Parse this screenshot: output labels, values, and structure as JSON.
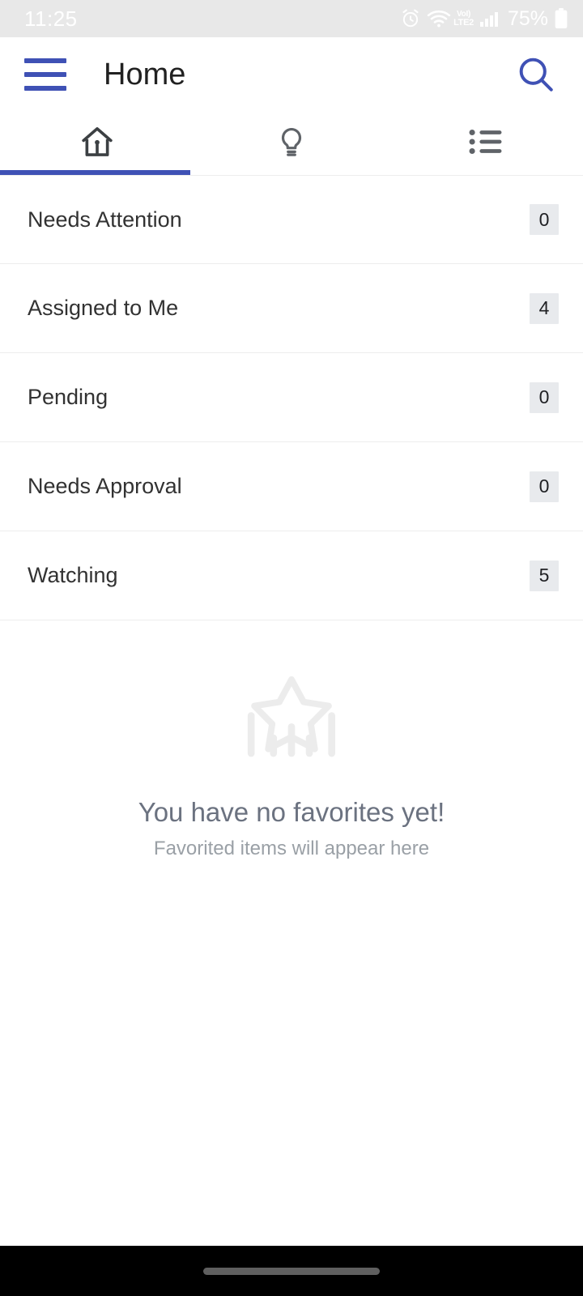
{
  "status_bar": {
    "time": "11:25",
    "battery_percent": "75%",
    "network_label_top": "VoI)",
    "network_label_bottom": "LTE2",
    "icons": [
      "alarm-icon",
      "wifi-icon",
      "volte-icon",
      "signal-icon",
      "battery-icon"
    ]
  },
  "app_bar": {
    "title": "Home",
    "menu_icon": "hamburger-menu-icon",
    "search_icon": "search-icon"
  },
  "tabs": [
    {
      "id": "home",
      "icon": "home-icon",
      "active": true
    },
    {
      "id": "ideas",
      "icon": "lightbulb-icon",
      "active": false
    },
    {
      "id": "lists",
      "icon": "bulleted-list-icon",
      "active": false
    }
  ],
  "list": {
    "rows": [
      {
        "label": "Needs Attention",
        "count": "0"
      },
      {
        "label": "Assigned to Me",
        "count": "4"
      },
      {
        "label": "Pending",
        "count": "0"
      },
      {
        "label": "Needs Approval",
        "count": "0"
      },
      {
        "label": "Watching",
        "count": "5"
      }
    ]
  },
  "empty_state": {
    "illustration": "star-with-bars-icon",
    "title": "You have no favorites yet!",
    "subtitle": "Favorited items will appear here"
  },
  "colors": {
    "accent_blue": "#3f51b5",
    "status_bar_bg": "#e8e8e8",
    "badge_bg": "#e8eaed",
    "divider": "#ededed",
    "empty_illustration": "#ececec",
    "empty_title_text": "#6b7280",
    "empty_subtitle_text": "#9aa0a6",
    "gesture_bar_bg": "#000000"
  }
}
